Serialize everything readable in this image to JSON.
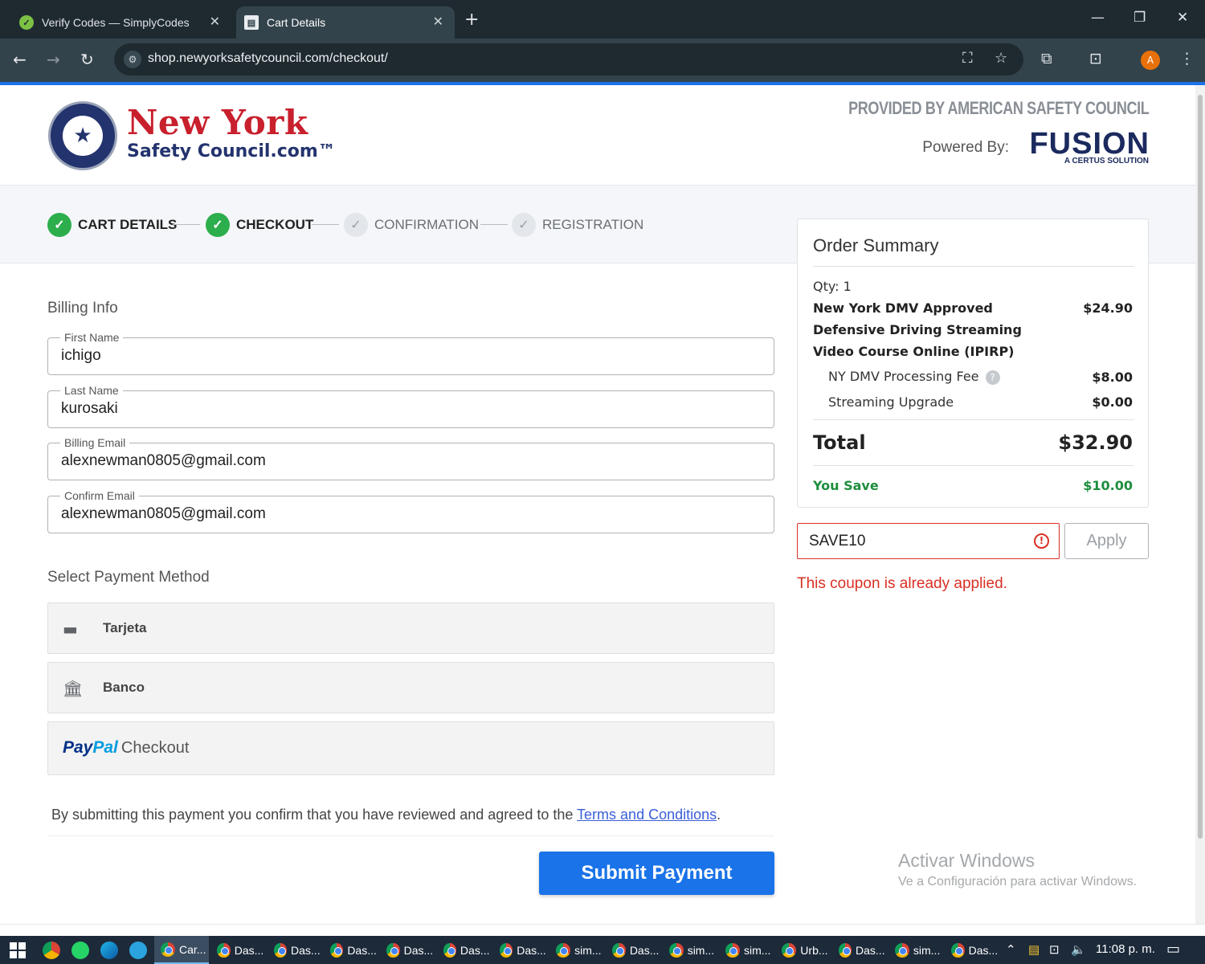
{
  "browser": {
    "tabs": [
      {
        "title": "Verify Codes — SimplyCodes",
        "active": false
      },
      {
        "title": "Cart Details",
        "active": true
      }
    ],
    "url": "shop.newyorksafetycouncil.com/checkout/",
    "profile_initial": "A"
  },
  "header": {
    "brand_line1": "New York",
    "brand_line2": "Safety Council.com™",
    "provided_by": "PROVIDED BY AMERICAN SAFETY COUNCIL",
    "powered_by": "Powered By:",
    "fusion_logo": "FUSION",
    "certus": "A CERTUS SOLUTION"
  },
  "steps": [
    {
      "label": "CART DETAILS",
      "status": "done"
    },
    {
      "label": "CHECKOUT",
      "status": "done"
    },
    {
      "label": "CONFIRMATION",
      "status": "pending"
    },
    {
      "label": "REGISTRATION",
      "status": "pending"
    }
  ],
  "billing": {
    "title": "Billing Info",
    "first_name": {
      "label": "First Name",
      "value": "ichigo"
    },
    "last_name": {
      "label": "Last Name",
      "value": "kurosaki"
    },
    "email": {
      "label": "Billing Email",
      "value": "alexnewman0805@gmail.com"
    },
    "confirm_email": {
      "label": "Confirm Email",
      "value": "alexnewman0805@gmail.com"
    }
  },
  "payment": {
    "title": "Select Payment Method",
    "methods": [
      {
        "label": "Tarjeta",
        "icon": "credit-card-icon"
      },
      {
        "label": "Banco",
        "icon": "bank-icon"
      }
    ],
    "paypal": {
      "pay": "Pay",
      "pal": "Pal",
      "checkout": "Checkout"
    }
  },
  "terms": {
    "text": "By submitting this payment you confirm that you have reviewed and agreed to the ",
    "link": "Terms and Conditions",
    "end": "."
  },
  "submit_label": "Submit Payment",
  "order_summary": {
    "title": "Order Summary",
    "qty": "Qty: 1",
    "product_line1": "New York DMV Approved",
    "product_line2": "Defensive Driving Streaming",
    "product_line3": "Video Course Online (IPIRP)",
    "product_price": "$24.90",
    "fees": [
      {
        "label": "NY DMV Processing Fee",
        "price": "$8.00"
      },
      {
        "label": "Streaming Upgrade",
        "price": "$0.00"
      }
    ],
    "total_label": "Total",
    "total_value": "$32.90",
    "save_label": "You Save",
    "save_value": "$10.00"
  },
  "coupon": {
    "value": "SAVE10",
    "apply_label": "Apply",
    "message": "This coupon is already applied."
  },
  "watermark": {
    "line1": "Activar Windows",
    "line2": "Ve a Configuración para activar Windows."
  },
  "taskbar": {
    "items": [
      "Car...",
      "Das...",
      "Das...",
      "Das...",
      "Das...",
      "Das...",
      "Das...",
      "sim...",
      "Das...",
      "sim...",
      "sim...",
      "Urb...",
      "Das...",
      "sim...",
      "Das..."
    ],
    "clock": "11:08 p. m."
  },
  "colors": {
    "accent": "#1a73e8",
    "success": "#2cae4c",
    "error": "#d93025",
    "savings": "#1e8e3e",
    "brand_red": "#c8202d",
    "brand_navy": "#23336e"
  }
}
